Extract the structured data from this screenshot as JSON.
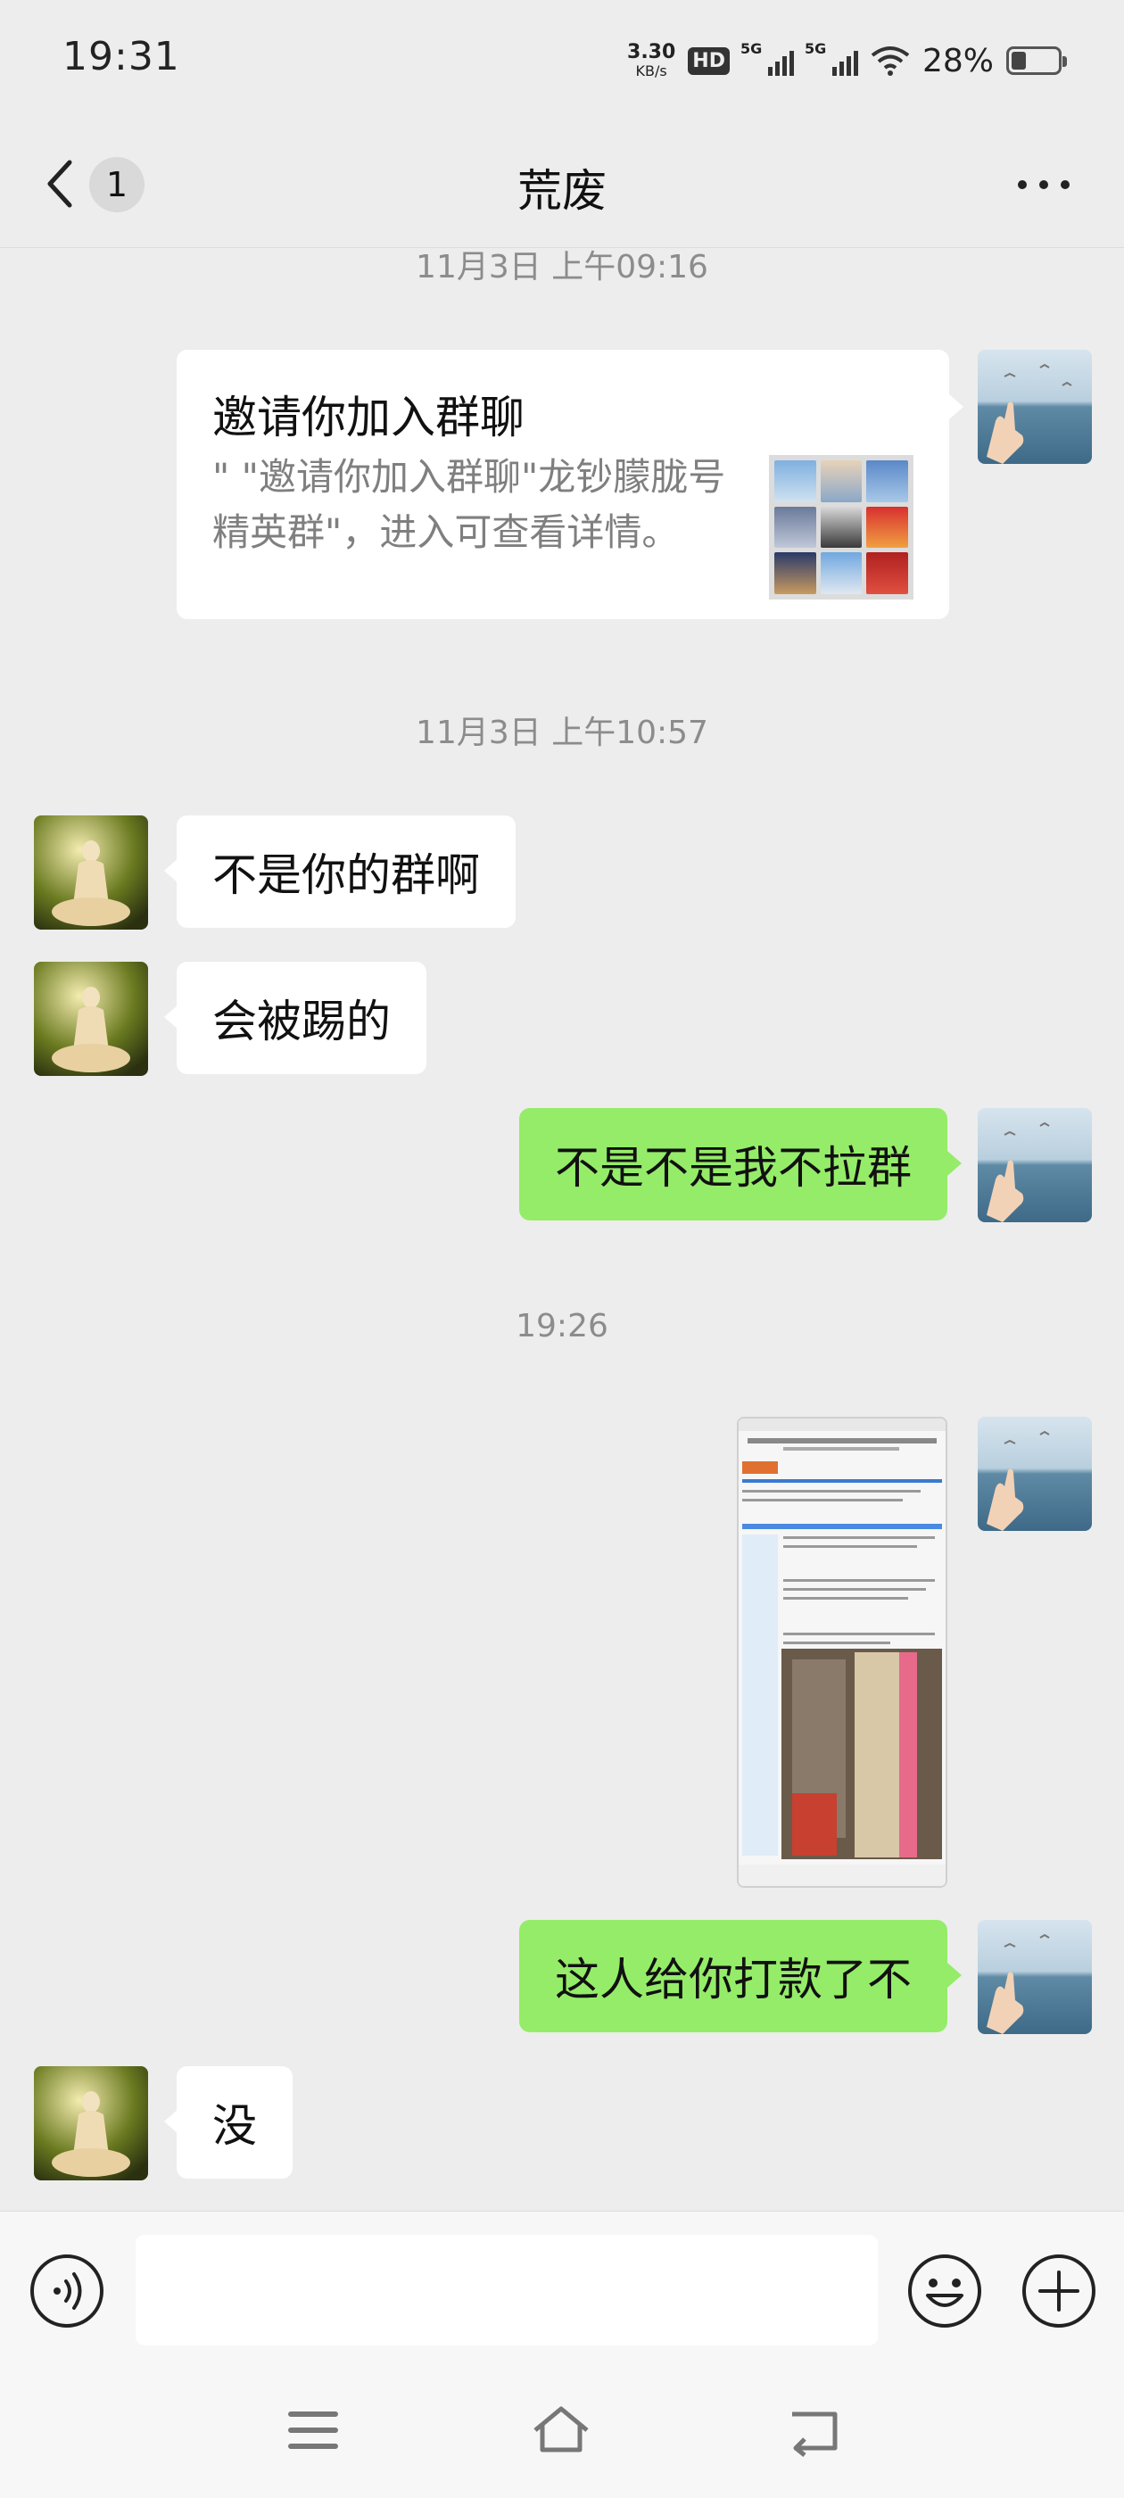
{
  "status_bar": {
    "time": "19:31",
    "net_speed_value": "3.30",
    "net_speed_unit": "KB/s",
    "hd_label": "HD",
    "signal_1_label": "5G",
    "signal_2_label": "5G",
    "battery_percent": "28%"
  },
  "nav": {
    "title": "荒废",
    "unread_count": "1"
  },
  "messages": {
    "ts1": "11月3日 上午09:16",
    "invite_title": "邀请你加入群聊",
    "invite_desc": "\"   \"邀请你加入群聊\"龙钞朦胧号精英群\"，进入可查看详情。",
    "ts2": "11月3日 上午10:57",
    "m1": "不是你的群啊",
    "m2": "会被踢的",
    "m3": "不是不是我不拉群",
    "ts3": "19:26",
    "m4": "这人给你打款了不",
    "m5": "没"
  },
  "colors": {
    "outgoing_bubble": "#95ec69",
    "incoming_bubble": "#ffffff",
    "background": "#ededed"
  },
  "icons": {
    "back": "chevron-left-icon",
    "more": "more-dots-icon",
    "voice": "voice-icon",
    "emoji": "emoji-icon",
    "plus": "plus-icon",
    "menu": "menu-icon",
    "home": "home-icon",
    "back_nav": "back-nav-icon"
  }
}
